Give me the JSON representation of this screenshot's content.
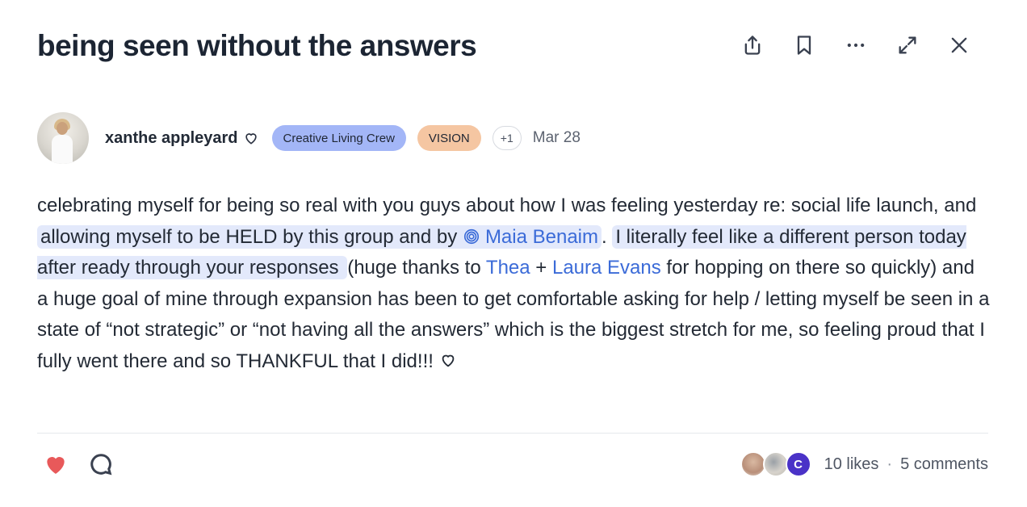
{
  "post": {
    "title": "being seen without the answers",
    "author": "xanthe appleyard",
    "badges": [
      "Creative Living Crew",
      "VISION"
    ],
    "more_badges": "+1",
    "date": "Mar 28",
    "body": {
      "p1": "celebrating myself for being so real with you guys about how I was feeling yesterday re: social life launch, and ",
      "hl1": "allowing myself to be HELD by this group and by ",
      "mention1": "Maia Benaim",
      "p2": ". ",
      "hl2": "I literally feel like a different person today after ready through your responses ",
      "p3": "(huge thanks to ",
      "mention2": "Thea",
      "p4": " + ",
      "mention3": "Laura Evans",
      "p5": " for hopping on there so quickly) and a huge goal of mine through expansion has been to get comfortable asking for help / letting myself be seen in a state of “not strategic” or “not having all the answers” which is the biggest stretch for me, so feeling proud that I fully went there and so THANKFUL that I did!!! "
    }
  },
  "footer": {
    "liker_initial": "C",
    "likes": "10 likes",
    "separator": "·",
    "comments": "5 comments"
  },
  "colors": {
    "like": "#e8595a",
    "mention": "#3b6bd8",
    "highlight": "#e3e9fb",
    "badge_crew": "#a3b6f7",
    "badge_vision": "#f5c6a2"
  },
  "icons": [
    "share-icon",
    "bookmark-icon",
    "more-icon",
    "expand-icon",
    "close-icon",
    "heart-outline-icon",
    "spiral-icon",
    "heart-filled-icon",
    "comment-icon"
  ]
}
